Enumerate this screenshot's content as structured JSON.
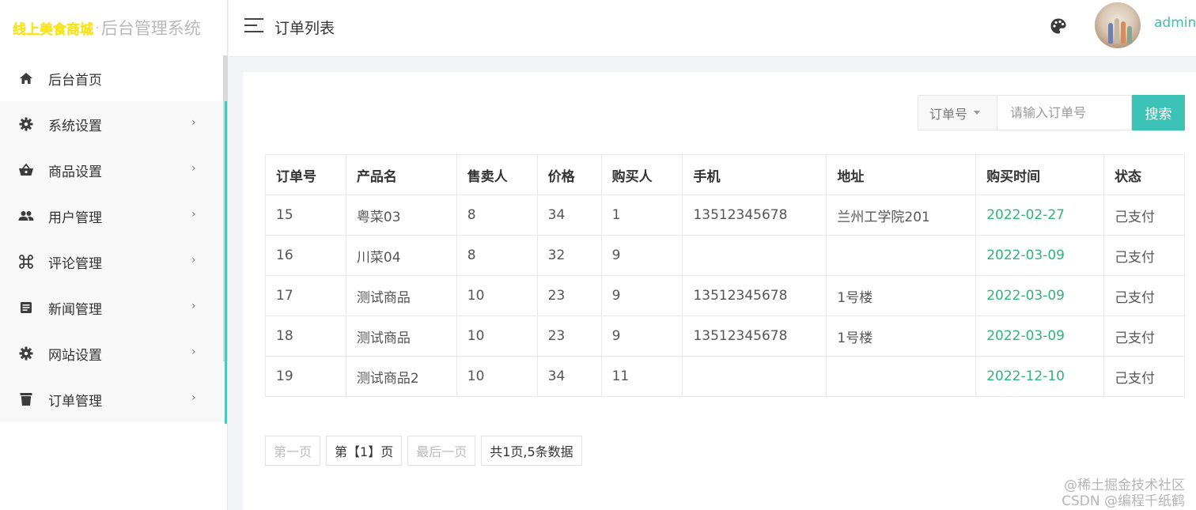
{
  "logo": {
    "brand": "线上美食商城",
    "dot": "·",
    "system": "后台管理系统"
  },
  "sidebar": {
    "items": [
      {
        "label": "后台首页",
        "icon": "home-icon",
        "has_arrow": false
      },
      {
        "label": "系统设置",
        "icon": "gear-icon",
        "has_arrow": true
      },
      {
        "label": "商品设置",
        "icon": "basket-icon",
        "has_arrow": true
      },
      {
        "label": "用户管理",
        "icon": "users-icon",
        "has_arrow": true
      },
      {
        "label": "评论管理",
        "icon": "command-icon",
        "has_arrow": true
      },
      {
        "label": "新闻管理",
        "icon": "article-icon",
        "has_arrow": true
      },
      {
        "label": "网站设置",
        "icon": "gear-icon",
        "has_arrow": true
      },
      {
        "label": "订单管理",
        "icon": "trash-icon",
        "has_arrow": true
      }
    ],
    "arrow": "›"
  },
  "header": {
    "title": "订单列表",
    "user": "admin",
    "accent_color": "#3cc3b5"
  },
  "search": {
    "field": "订单号",
    "placeholder": "请输入订单号",
    "button": "搜索"
  },
  "table": {
    "columns": [
      "订单号",
      "产品名",
      "售卖人",
      "价格",
      "购买人",
      "手机",
      "地址",
      "购买时间",
      "状态"
    ],
    "rows": [
      [
        "15",
        "粤菜03",
        "8",
        "34",
        "1",
        "13512345678",
        "兰州工学院201",
        "2022-02-27",
        "己支付"
      ],
      [
        "16",
        "川菜04",
        "8",
        "32",
        "9",
        "",
        "",
        "2022-03-09",
        "己支付"
      ],
      [
        "17",
        "测试商品",
        "10",
        "23",
        "9",
        "13512345678",
        "1号楼",
        "2022-03-09",
        "己支付"
      ],
      [
        "18",
        "测试商品",
        "10",
        "23",
        "9",
        "13512345678",
        "1号楼",
        "2022-03-09",
        "己支付"
      ],
      [
        "19",
        "测试商品2",
        "10",
        "34",
        "11",
        "",
        "",
        "2022-12-10",
        "己支付"
      ]
    ]
  },
  "pagination": {
    "first": "第一页",
    "current": "第【1】页",
    "last": "最后一页",
    "summary": "共1页,5条数据"
  },
  "watermark": {
    "line1": "@稀土掘金技术社区",
    "line2": "CSDN @编程千纸鹤"
  }
}
